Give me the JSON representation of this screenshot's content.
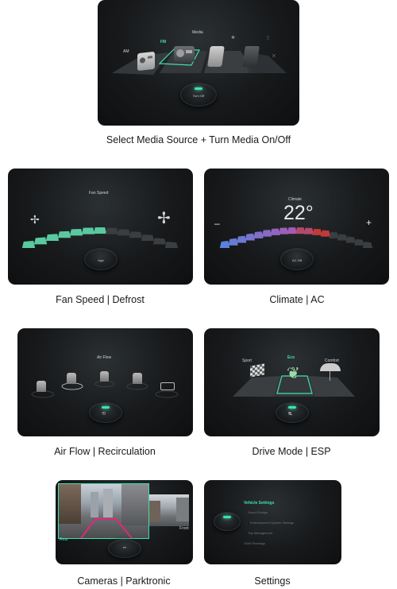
{
  "colors": {
    "accent": "#3fe0b0",
    "panel_bg": "#17191b",
    "caption_text": "#1a1a1a"
  },
  "panels": {
    "media": {
      "caption": "Select Media Source + Turn Media On/Off",
      "label_am": "AM",
      "label_fm": "FM",
      "label_media": "Media",
      "knob_label": "Turn Off",
      "icons": [
        "radio-icon",
        "radio-icon",
        "phone-icon",
        "tablet-icon",
        "bluetooth-off-icon"
      ]
    },
    "fan": {
      "caption": "Fan Speed | Defrost",
      "title": "Fan Speed",
      "knob_label": "high",
      "level": 0.5
    },
    "climate": {
      "caption": "Climate | AC",
      "title": "Climate",
      "temperature": "22°",
      "minus": "–",
      "plus": "+",
      "knob_label": "AC Off"
    },
    "airflow": {
      "caption": "Air Flow | Recirculation",
      "title": "Air Flow",
      "icons": [
        "seat-feet-icon",
        "seat-body-icon",
        "seat-body-feet-icon",
        "seat-face-icon",
        "windshield-icon"
      ]
    },
    "drive": {
      "caption": "Drive Mode | ESP",
      "label_sport": "Sport",
      "label_eco": "Eco",
      "label_comfort": "Comfort"
    },
    "cameras": {
      "caption": "Cameras | Parktronic",
      "label_rear": "Rear",
      "label_front": "Front"
    },
    "settings": {
      "caption": "Settings",
      "items": [
        "Vehicle Settings",
        "Sound Design",
        "Entertainment System Settings",
        "Trip Management",
        "OEM Readings"
      ]
    }
  }
}
